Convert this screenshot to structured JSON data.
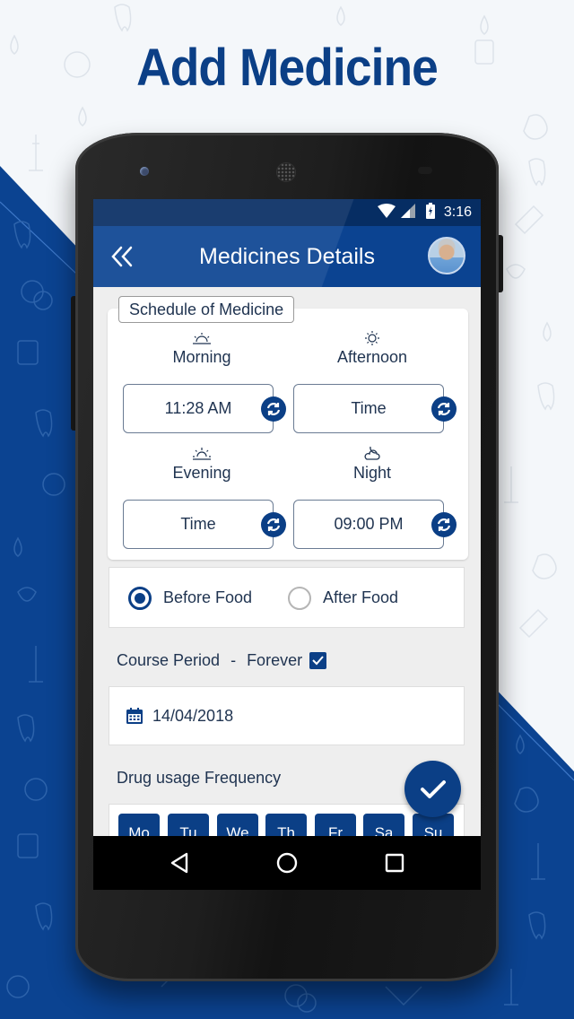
{
  "promo": {
    "title": "Add Medicine"
  },
  "statusbar": {
    "time": "3:16",
    "icons": [
      "wifi-icon",
      "cell-signal-icon",
      "battery-charging-icon"
    ]
  },
  "appbar": {
    "title": "Medicines Details",
    "back_icon": "double-chevron-left-icon",
    "avatar": "user-avatar"
  },
  "schedule": {
    "legend": "Schedule of Medicine",
    "slots": [
      {
        "label": "Morning",
        "icon": "sunrise-icon",
        "value": "11:28 AM"
      },
      {
        "label": "Afternoon",
        "icon": "sun-icon",
        "value": "Time"
      },
      {
        "label": "Evening",
        "icon": "sunset-icon",
        "value": "Time"
      },
      {
        "label": "Night",
        "icon": "moon-cloud-icon",
        "value": "09:00 PM"
      }
    ],
    "refresh_icon": "refresh-icon"
  },
  "food": {
    "options": [
      {
        "label": "Before Food",
        "selected": true
      },
      {
        "label": "After Food",
        "selected": false
      }
    ]
  },
  "course": {
    "label": "Course Period",
    "separator": "-",
    "forever_label": "Forever",
    "forever_checked": true
  },
  "start_date": {
    "value": "14/04/2018",
    "icon": "calendar-icon"
  },
  "frequency": {
    "label": "Drug usage Frequency",
    "days": [
      "Mo",
      "Tu",
      "We",
      "Th",
      "Fr",
      "Sa",
      "Su"
    ]
  },
  "fab": {
    "icon": "checkmark-icon"
  },
  "navbar": {
    "buttons": [
      "back-triangle-icon",
      "home-circle-icon",
      "recents-square-icon"
    ]
  },
  "colors": {
    "primary": "#0b3f86",
    "statusbar": "#062d63",
    "text": "#1f3350",
    "background_blue": "#0b4391"
  }
}
